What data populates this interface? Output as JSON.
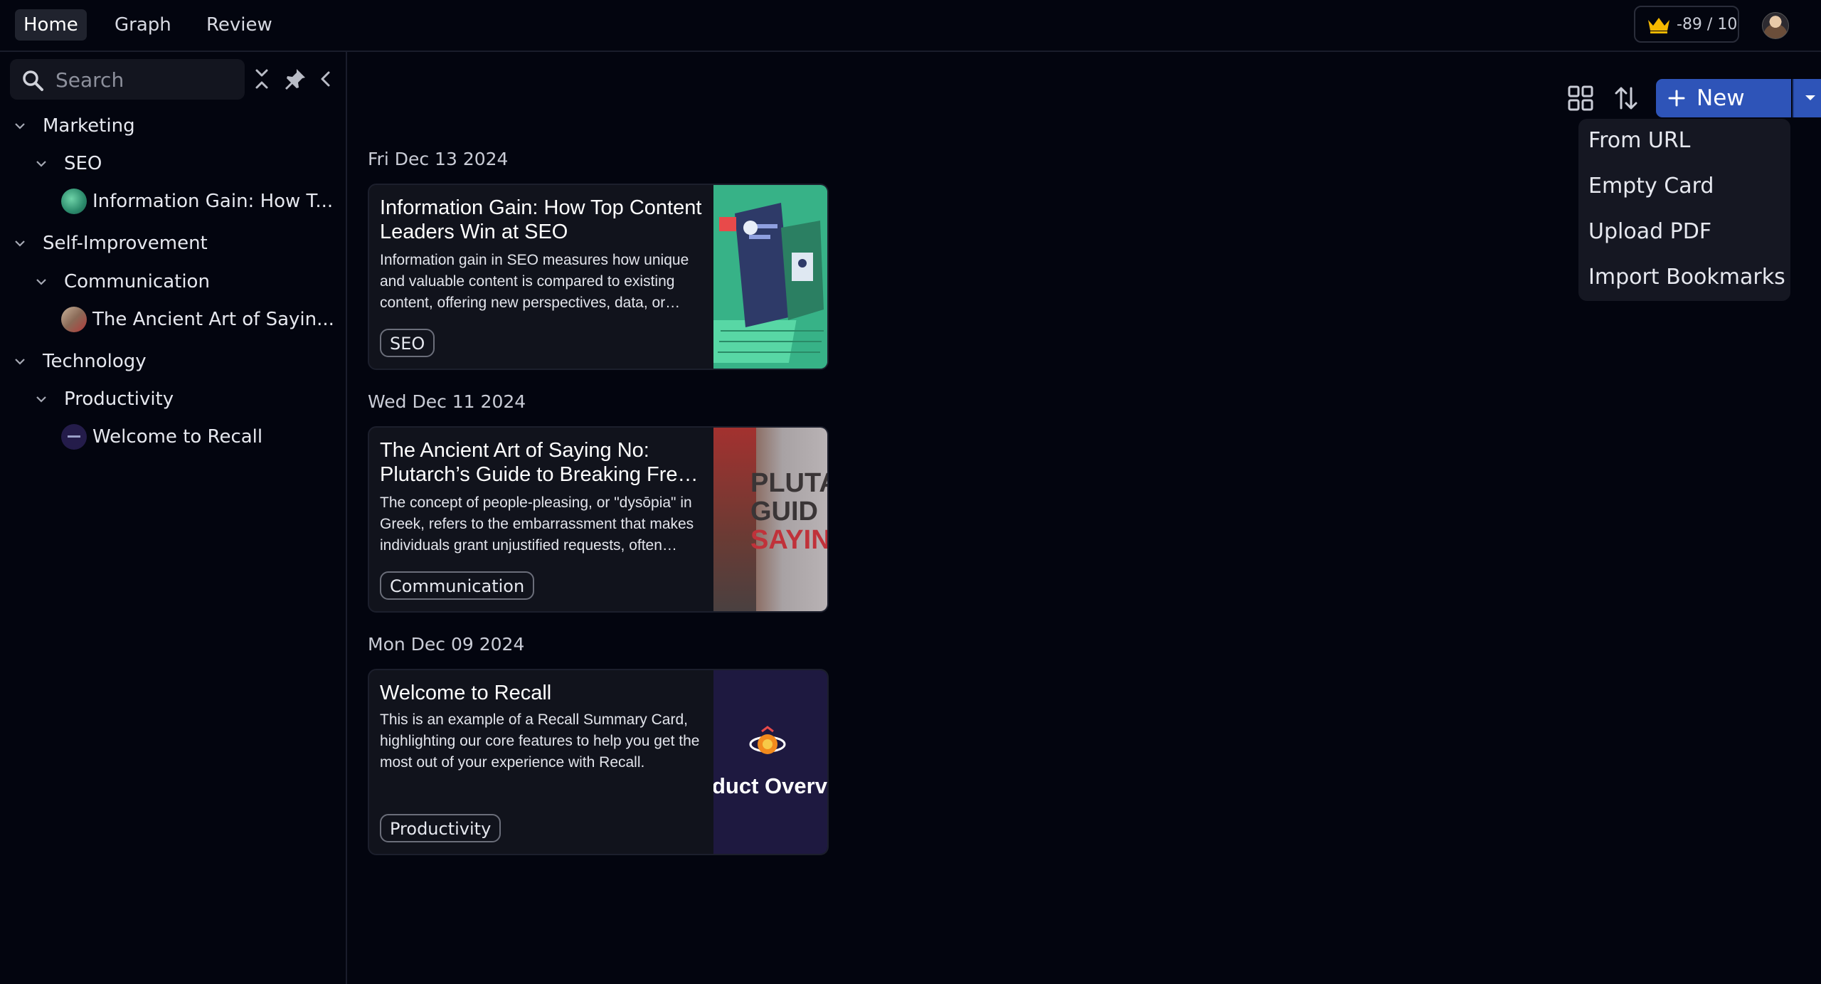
{
  "nav": {
    "tabs": [
      {
        "label": "Home"
      },
      {
        "label": "Graph"
      },
      {
        "label": "Review"
      }
    ]
  },
  "credits": {
    "text": "-89 / 10"
  },
  "colors": {
    "accent": "#2e54b8",
    "background": "#03050f",
    "crown": "#f5b800"
  },
  "search": {
    "placeholder": "Search",
    "value": ""
  },
  "sidebar": {
    "tree": [
      {
        "label": "Marketing",
        "children": [
          {
            "label": "SEO",
            "items": [
              {
                "label": "Information Gain: How T..."
              }
            ]
          }
        ]
      },
      {
        "label": "Self-Improvement",
        "children": [
          {
            "label": "Communication",
            "items": [
              {
                "label": "The Ancient Art of Sayin..."
              }
            ]
          }
        ]
      },
      {
        "label": "Technology",
        "children": [
          {
            "label": "Productivity",
            "items": [
              {
                "label": "Welcome to Recall"
              }
            ]
          }
        ]
      }
    ]
  },
  "toolbar": {
    "new_label": "New"
  },
  "new_menu": {
    "items": [
      {
        "label": "From URL"
      },
      {
        "label": "Empty Card"
      },
      {
        "label": "Upload PDF"
      },
      {
        "label": "Import Bookmarks"
      }
    ]
  },
  "feed": [
    {
      "date": "Fri Dec 13 2024",
      "title": "Information Gain: How Top Content Leaders Win at SEO",
      "description": "Information gain in SEO measures how unique and valuable content is compared to existing content, offering new perspectives, data, or…",
      "tag": "SEO"
    },
    {
      "date": "Wed Dec 11 2024",
      "title": "The Ancient Art of Saying No: Plutarch’s Guide to Breaking Fre…",
      "description": "The concept of people-pleasing, or \"dysōpia\" in Greek, refers to the embarrassment that makes individuals grant unjustified requests, often…",
      "tag": "Communication",
      "image_text": [
        "PLUTA",
        "GUID",
        "SAYIN"
      ]
    },
    {
      "date": "Mon Dec 09 2024",
      "title": "Welcome to Recall",
      "description": "This is an example of a Recall Summary Card, highlighting our core features to help you get the most out of your experience with Recall.",
      "tag": "Productivity",
      "image_text": "duct Overv"
    }
  ]
}
